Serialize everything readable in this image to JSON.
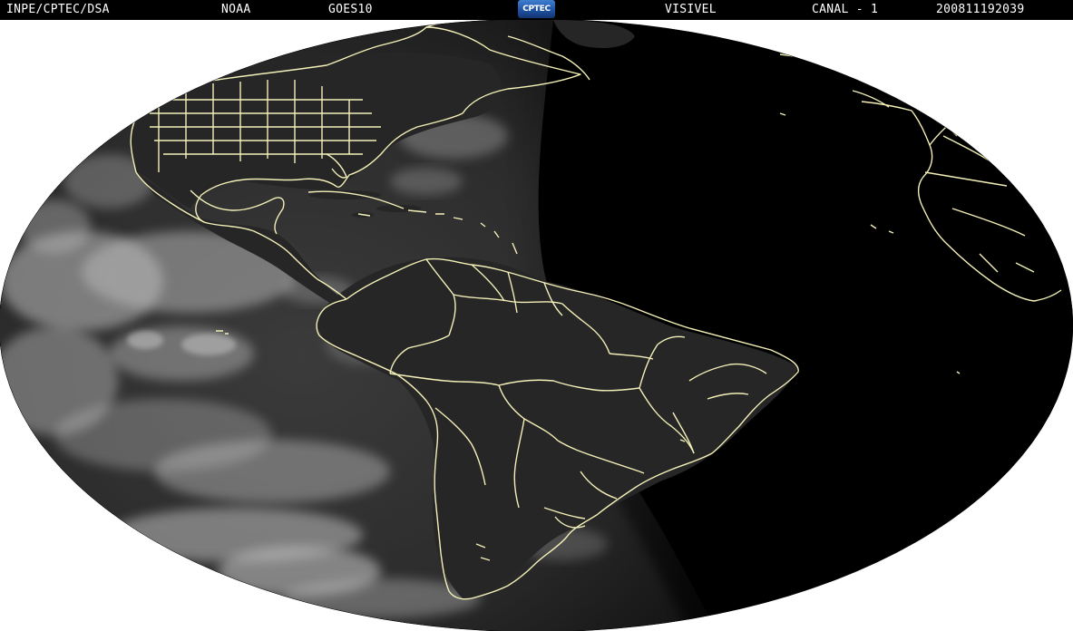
{
  "header": {
    "agency": "INPE/CPTEC/DSA",
    "operator": "NOAA",
    "satellite": "GOES10",
    "channel_type": "VISIVEL",
    "channel": "CANAL - 1",
    "timestamp": "200811192039"
  },
  "logo": {
    "text": "CPTEC",
    "icon": "cptec-logo"
  },
  "image": {
    "projection": "hammer-aitoff",
    "subject": "satellite-visible-image-americas",
    "colors": {
      "space": "#ffffff",
      "night": "#000000",
      "day_ocean": "#3a3a3a",
      "cloud": "#cfcfcf",
      "coastline": "#f3efb4"
    }
  }
}
